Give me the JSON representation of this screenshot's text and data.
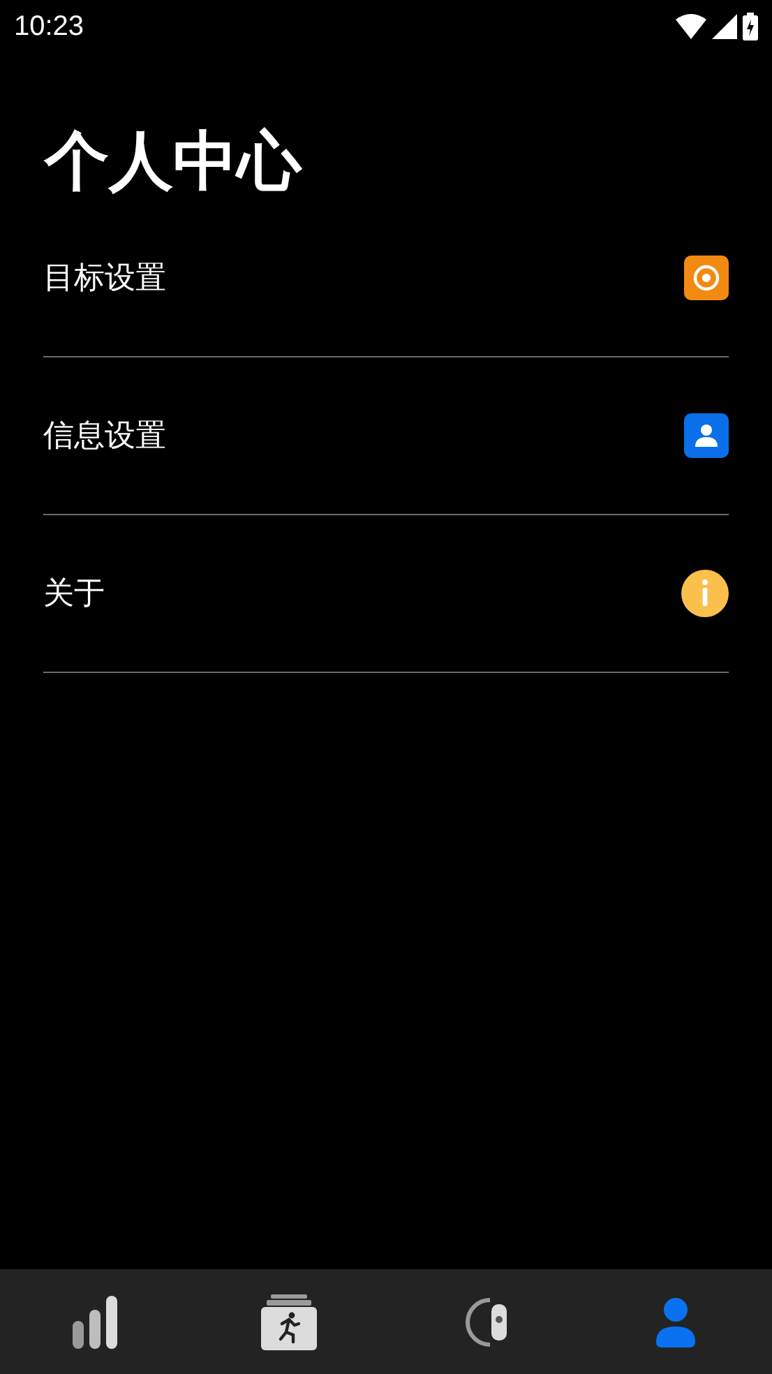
{
  "status_bar": {
    "time": "10:23"
  },
  "title": "个人中心",
  "menu": [
    {
      "label": "目标设置",
      "kind": "target"
    },
    {
      "label": "信息设置",
      "kind": "profile"
    },
    {
      "label": "关于",
      "kind": "info"
    }
  ],
  "tabs": [
    {
      "kind": "stats",
      "selected": false
    },
    {
      "kind": "activity",
      "selected": false
    },
    {
      "kind": "device",
      "selected": false
    },
    {
      "kind": "profile",
      "selected": true
    }
  ]
}
